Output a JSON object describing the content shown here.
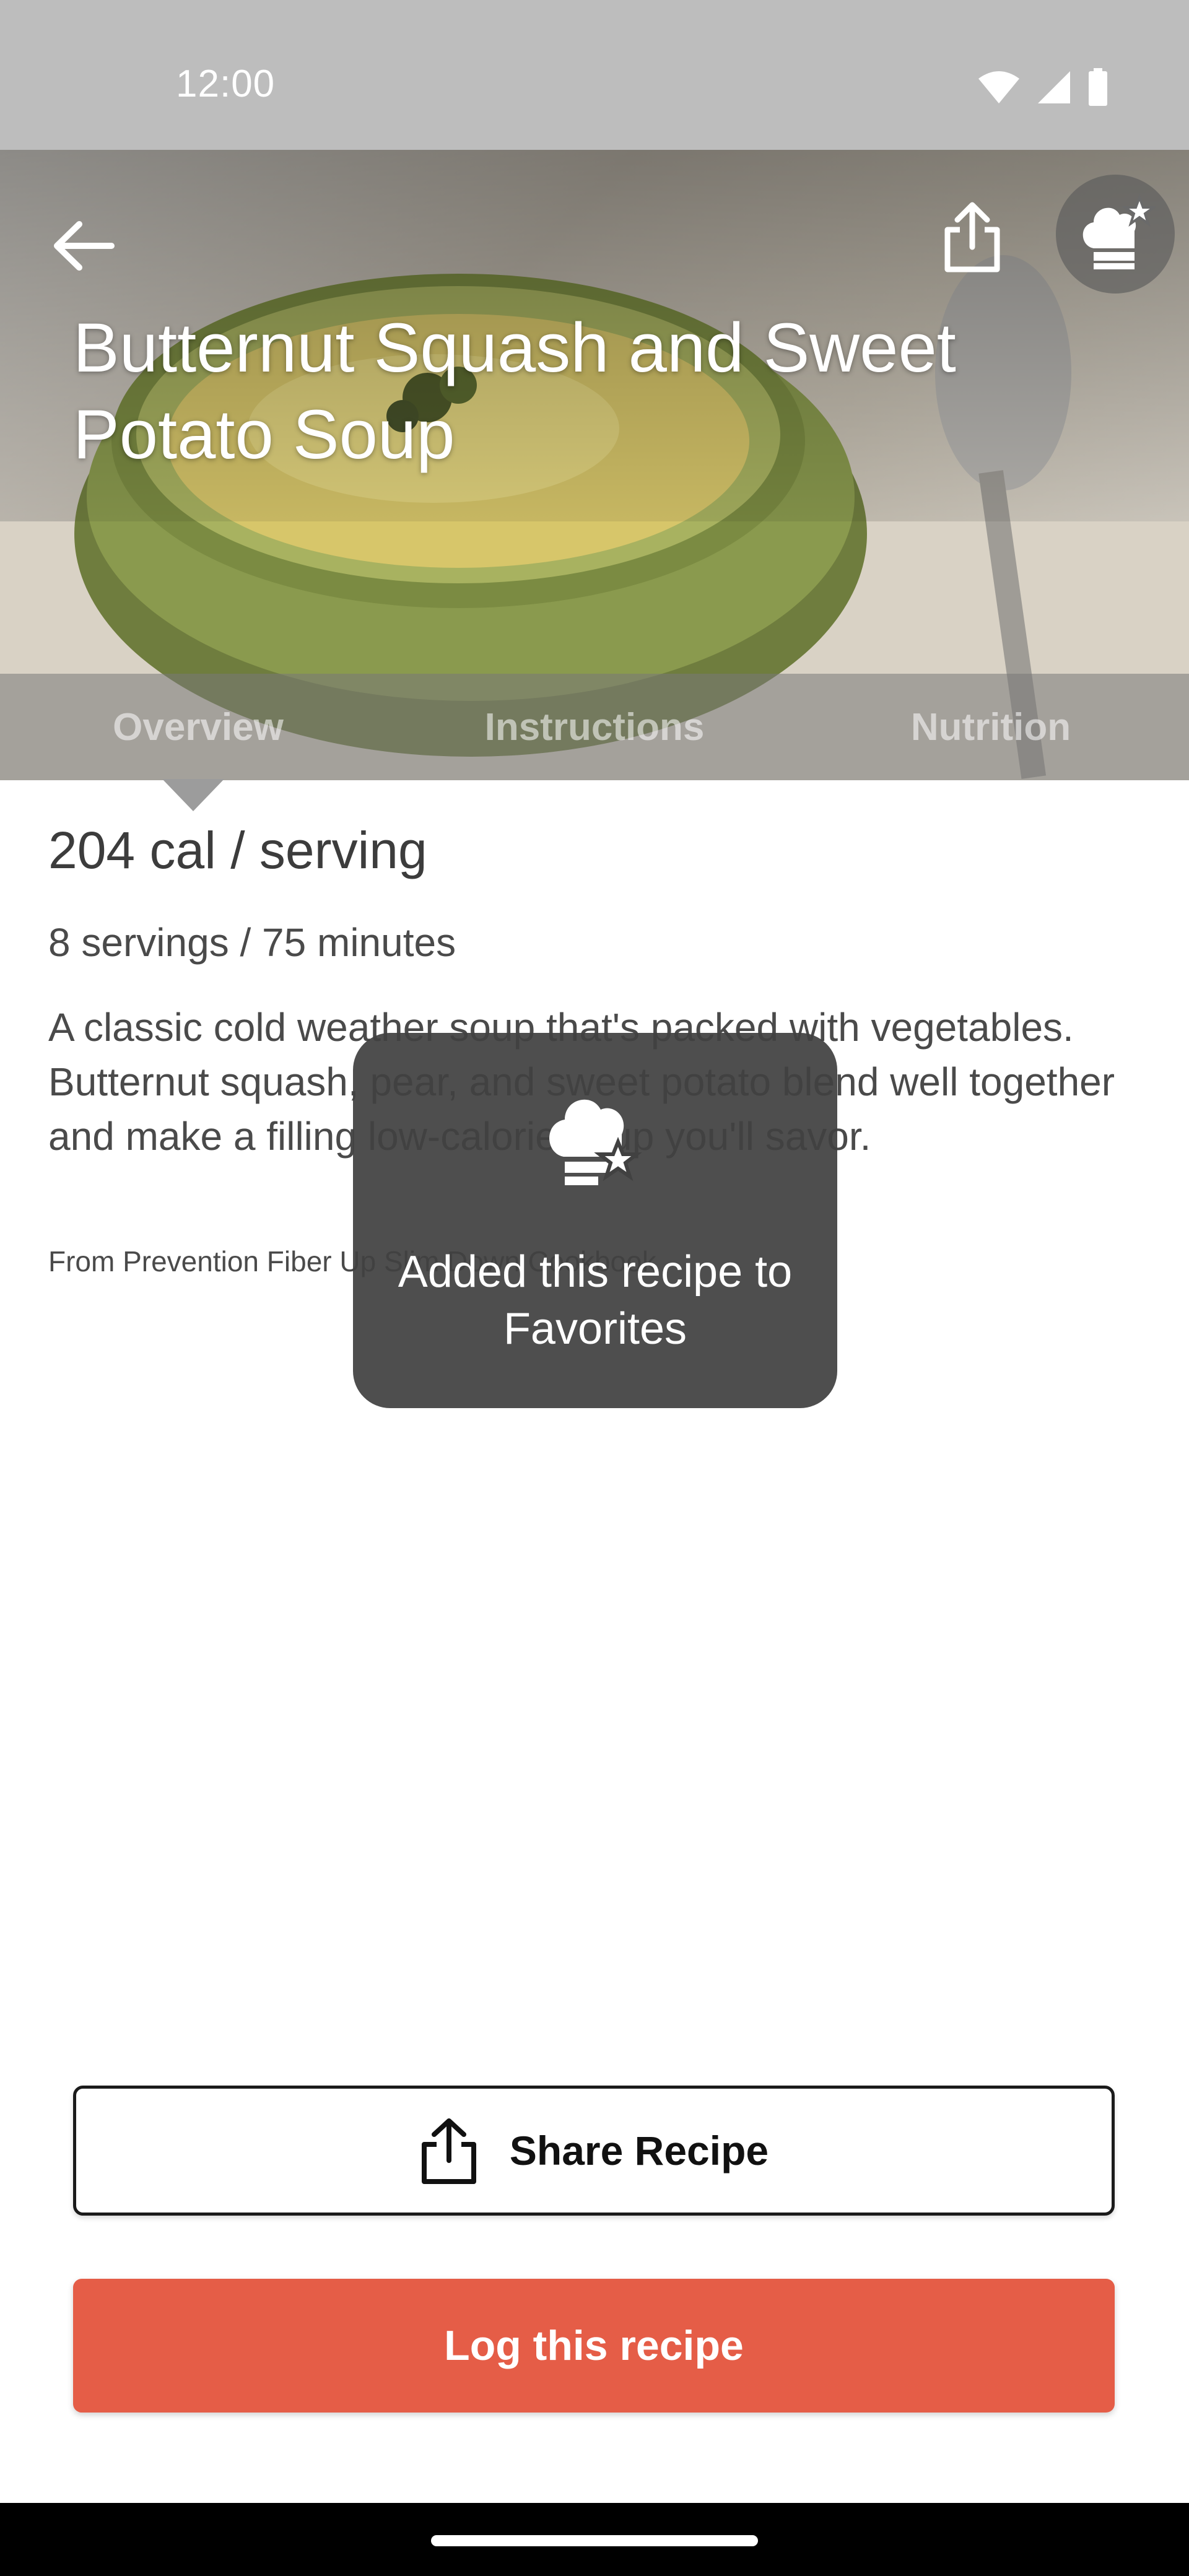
{
  "status_bar": {
    "time": "12:00",
    "icons": [
      "wifi-icon",
      "cellular-icon",
      "battery-icon"
    ]
  },
  "header": {
    "title": "Butternut Squash and Sweet Potato Soup",
    "icons": [
      "back-arrow-icon",
      "share-icon",
      "favorite-chef-hat-icon"
    ]
  },
  "tabs": [
    {
      "label": "Overview",
      "selected": true
    },
    {
      "label": "Instructions",
      "selected": false
    },
    {
      "label": "Nutrition",
      "selected": false
    }
  ],
  "overview": {
    "calories": "204 cal / serving",
    "servings": "8 servings / 75 minutes",
    "description": "A classic cold weather soup that's packed with vegetables. Butternut squash, pear, and sweet potato blend well together and make a filling low-calorie soup you'll savor.",
    "source": "From Prevention Fiber Up Slim Down Cookbook"
  },
  "toast": {
    "message": "Added this recipe to Favorites",
    "icon": "chef-hat-star-icon"
  },
  "actions": {
    "share_label": "Share Recipe",
    "log_label": "Log this recipe"
  },
  "colors": {
    "accent": "#e55d47",
    "status_bar": "#bdbdbd",
    "toast_bg": "#414141"
  }
}
